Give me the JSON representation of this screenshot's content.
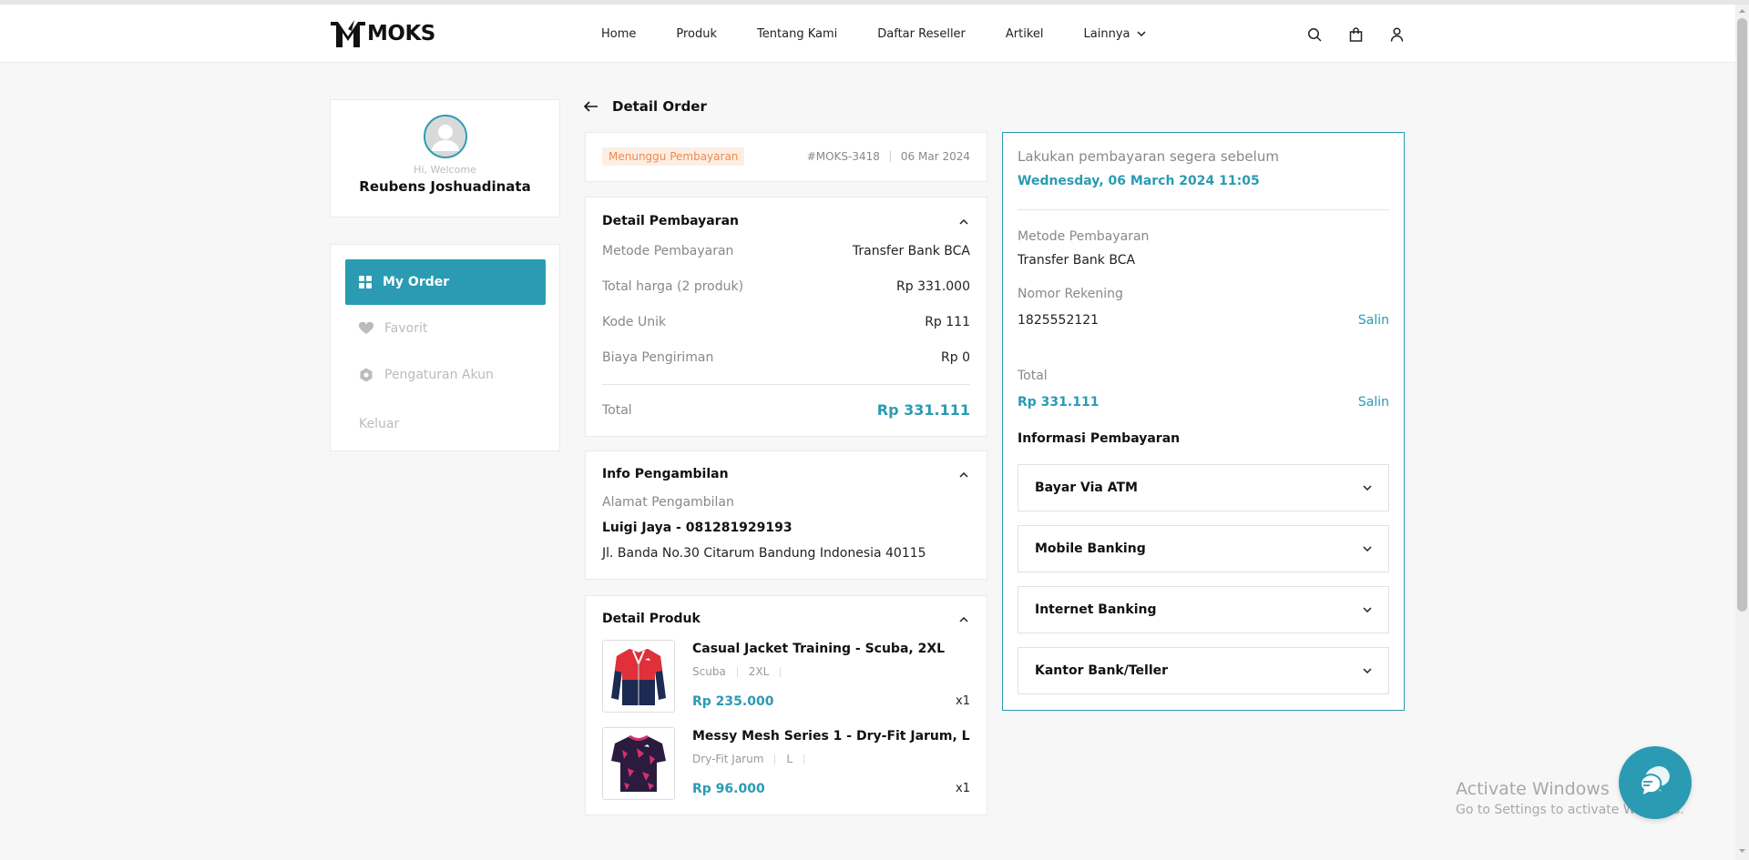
{
  "brand": {
    "logo_text": "MOKS"
  },
  "nav": {
    "items": [
      {
        "label": "Home"
      },
      {
        "label": "Produk"
      },
      {
        "label": "Tentang Kami"
      },
      {
        "label": "Daftar Reseller"
      },
      {
        "label": "Artikel"
      },
      {
        "label": "Lainnya"
      }
    ]
  },
  "header_icons": [
    "search-icon",
    "shopping-bag-icon",
    "user-icon"
  ],
  "profile": {
    "welcome": "Hi, Welcome",
    "name": "Reubens Joshuadinata"
  },
  "sidebar": {
    "items": [
      {
        "label": "My Order",
        "icon": "grid-icon",
        "active": true
      },
      {
        "label": "Favorit",
        "icon": "heart-icon"
      },
      {
        "label": "Pengaturan Akun",
        "icon": "settings-icon"
      },
      {
        "label": "Keluar"
      }
    ]
  },
  "page": {
    "title": "Detail Order"
  },
  "order": {
    "status": "Menunggu Pembayaran",
    "id": "#MOKS-3418",
    "date": "06 Mar 2024"
  },
  "payment_detail": {
    "title": "Detail Pembayaran",
    "rows": [
      {
        "label": "Metode Pembayaran",
        "value": "Transfer Bank BCA"
      },
      {
        "label": "Total harga (2 produk)",
        "value": "Rp 331.000"
      },
      {
        "label": "Kode Unik",
        "value": "Rp 111"
      },
      {
        "label": "Biaya Pengiriman",
        "value": "Rp 0"
      }
    ],
    "total_label": "Total",
    "total_value": "Rp 331.111"
  },
  "pickup": {
    "title": "Info Pengambilan",
    "label": "Alamat Pengambilan",
    "name": "Luigi Jaya - 081281929193",
    "address": "Jl. Banda No.30 Citarum Bandung Indonesia 40115"
  },
  "products": {
    "title": "Detail Produk",
    "items": [
      {
        "name": "Casual Jacket Training - Scuba, 2XL",
        "material": "Scuba",
        "size": "2XL",
        "price": "Rp 235.000",
        "qty": "x1"
      },
      {
        "name": "Messy Mesh Series 1 - Dry-Fit Jarum, L",
        "material": "Dry-Fit Jarum",
        "size": "L",
        "price": "Rp 96.000",
        "qty": "x1"
      }
    ]
  },
  "instructions": {
    "deadline_label": "Lakukan pembayaran segera sebelum",
    "deadline": "Wednesday, 06 March 2024 11:05",
    "method_label": "Metode Pembayaran",
    "method": "Transfer Bank BCA",
    "account_label": "Nomor Rekening",
    "account": "1825552121",
    "copy_label": "Salin",
    "total_label": "Total",
    "total": "Rp 331.111",
    "info_title": "Informasi Pembayaran",
    "accordions": [
      {
        "label": "Bayar Via ATM"
      },
      {
        "label": "Mobile Banking"
      },
      {
        "label": "Internet Banking"
      },
      {
        "label": "Kantor Bank/Teller"
      }
    ]
  },
  "watermark": {
    "line1": "Activate Windows",
    "line2": "Go to Settings to activate Windows."
  },
  "colors": {
    "accent": "#2a9bb3",
    "status_text": "#f08a4b",
    "status_bg": "#fdeee4"
  }
}
